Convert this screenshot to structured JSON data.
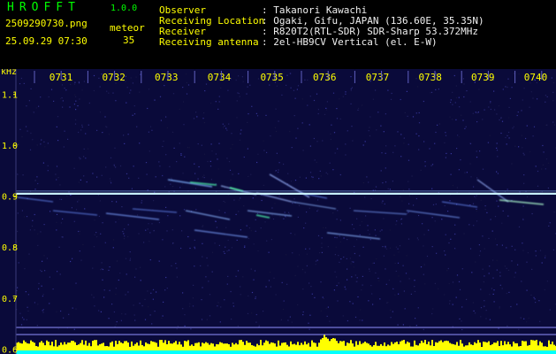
{
  "header": {
    "logo": "HROFFT",
    "version": "1.0.0",
    "filename": "2509290730.png",
    "datetime": "25.09.29 07:30",
    "meteor_label": "meteor",
    "meteor_count": "35",
    "info": [
      {
        "key": "Observer",
        "value": ": Takanori Kawachi"
      },
      {
        "key": "Receiving Location",
        "value": ": Ogaki, Gifu, JAPAN (136.60E, 35.35N)"
      },
      {
        "key": "Receiver",
        "value": ": R820T2(RTL-SDR) SDR-Sharp 53.372MHz"
      },
      {
        "key": "Receiving antenna",
        "value": ": 2el-HB9CV Vertical (el. E-W)"
      }
    ]
  },
  "chart_data": {
    "type": "heatmap",
    "ylabel": "kHz",
    "time_labels": [
      "0731",
      "0732",
      "0733",
      "0734",
      "0735",
      "0736",
      "0737",
      "0738",
      "0739",
      "0740"
    ],
    "y_ticks": [
      "1.1",
      "1.0",
      "0.9",
      "0.8",
      "0.7",
      "0.6"
    ],
    "y_tick_values": [
      1.1,
      1.0,
      0.9,
      0.8,
      0.7,
      0.6
    ],
    "ylim": [
      0.59,
      1.15
    ],
    "carrier_khz": 0.905,
    "meteor_count": 35,
    "colors": {
      "background": "#0a0a3a",
      "axis_text": "#ffff00",
      "carrier": "#c8f0ff",
      "trail": "#8ab4ff",
      "baseline": "#9090ff",
      "level_yellow": "#ffff00",
      "level_cyan": "#00ffff"
    }
  }
}
